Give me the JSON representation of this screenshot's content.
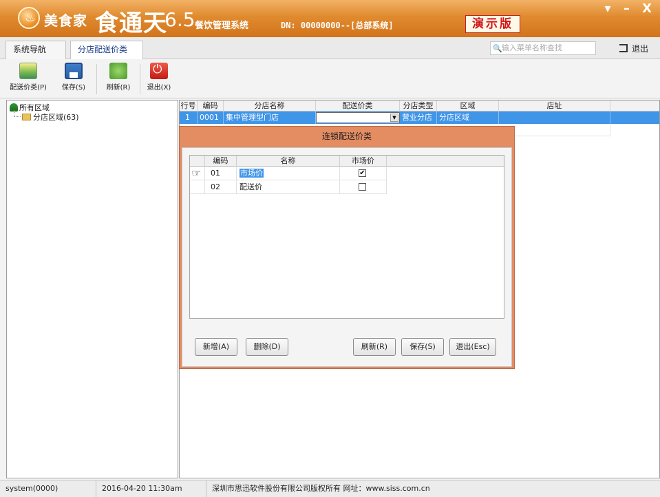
{
  "title_bar": {
    "brand": "美食家",
    "product": "食通天",
    "version": "6.5",
    "system_name": "餐饮管理系统",
    "dn": "DN: 00000000--[总部系统]",
    "demo_badge": "演示版",
    "window_controls": "▾ – X"
  },
  "tabs": {
    "nav_label": "系统导航",
    "active_label": "分店配送价类",
    "close": "✕",
    "search_placeholder": "输入菜单名称查找",
    "logout": "退出"
  },
  "toolbar": {
    "items": [
      {
        "label": "配送价类(P)",
        "icon": "category-image-icon"
      },
      {
        "label": "保存(S)",
        "icon": "save-disk-icon"
      },
      {
        "label": "刷新(R)",
        "icon": "refresh-icon"
      },
      {
        "label": "退出(X)",
        "icon": "power-exit-icon"
      }
    ]
  },
  "tree": {
    "root": "所有区域",
    "child": "分店区域(63)"
  },
  "grid": {
    "headers": [
      "行号",
      "编码",
      "分店名称",
      "配送价类",
      "分店类型",
      "区域",
      "店址"
    ],
    "rows": [
      {
        "line": "1",
        "code": "0001",
        "name": "集中管理型门店",
        "price_class": "",
        "type": "营业分店",
        "region": "分店区域",
        "address": ""
      }
    ]
  },
  "dialog": {
    "title": "连锁配送价类",
    "headers": [
      "编码",
      "名称",
      "市场价"
    ],
    "rows": [
      {
        "code": "01",
        "name": "市场价",
        "market_price": true
      },
      {
        "code": "02",
        "name": "配送价",
        "market_price": false
      }
    ],
    "buttons": {
      "add": "新增(A)",
      "delete": "删除(D)",
      "refresh": "刷新(R)",
      "save": "保存(S)",
      "exit": "退出(Esc)"
    }
  },
  "status_bar": {
    "user": "system(0000)",
    "datetime": "2016-04-20 11:30am",
    "copyright": "深圳市思迅软件股份有限公司版权所有 网址：www.siss.com.cn"
  },
  "colors": {
    "title_orange": "#e08a2e",
    "dialog_border": "#e48c62",
    "selection_blue": "#3f95e8",
    "demo_red": "#d01818"
  }
}
